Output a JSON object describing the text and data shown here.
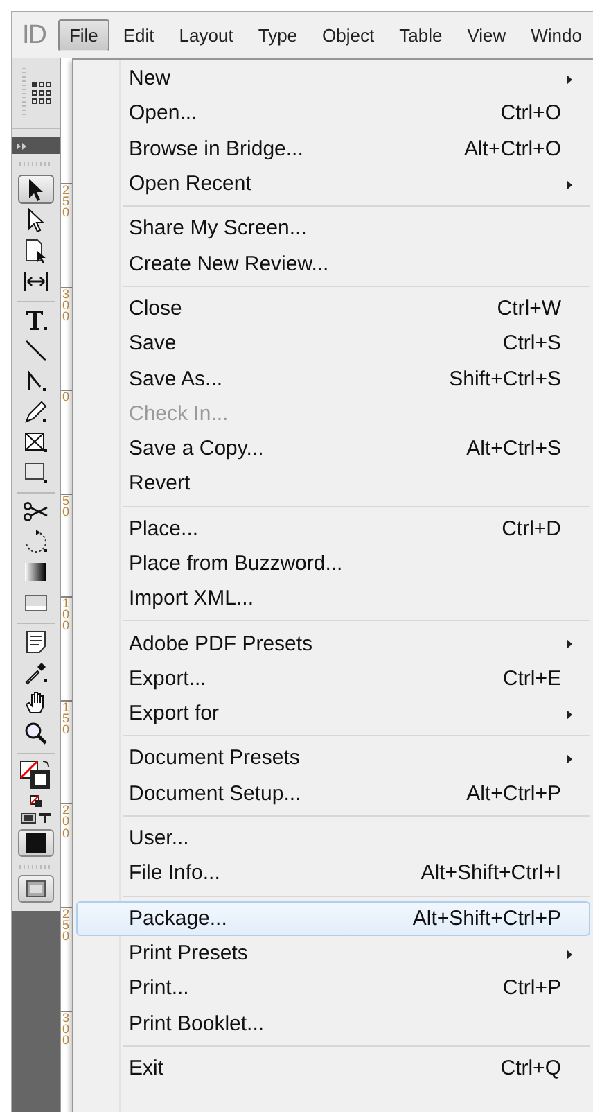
{
  "app": {
    "logo": "ID"
  },
  "menu_bar": [
    {
      "label": "File",
      "selected": true
    },
    {
      "label": "Edit",
      "selected": false
    },
    {
      "label": "Layout",
      "selected": false
    },
    {
      "label": "Type",
      "selected": false
    },
    {
      "label": "Object",
      "selected": false
    },
    {
      "label": "Table",
      "selected": false
    },
    {
      "label": "View",
      "selected": false
    },
    {
      "label": "Windo",
      "selected": false
    }
  ],
  "toolbar": {
    "groups": [
      [
        {
          "selected": true
        },
        {
          "selected": false
        },
        {
          "selected": false
        },
        {
          "selected": false
        }
      ],
      [
        {
          "selected": false
        },
        {
          "selected": false
        },
        {
          "selected": false
        },
        {
          "selected": false
        },
        {
          "selected": false
        },
        {
          "selected": false
        }
      ],
      [
        {
          "selected": false
        },
        {
          "selected": false
        },
        {
          "selected": false
        },
        {
          "selected": false
        }
      ],
      [
        {
          "selected": false
        },
        {
          "selected": false
        },
        {
          "selected": false
        },
        {
          "selected": false
        }
      ]
    ]
  },
  "ruler": {
    "labels": [
      "250",
      "300",
      "0",
      "50",
      "100",
      "150",
      "200",
      "250",
      "300"
    ]
  },
  "file_menu": {
    "sections": [
      {
        "items": [
          {
            "label": "New",
            "submenu": true,
            "disabled": false,
            "selected": false
          },
          {
            "label": "Open...",
            "shortcut": "Ctrl+O",
            "submenu": false,
            "disabled": false,
            "selected": false
          },
          {
            "label": "Browse in Bridge...",
            "shortcut": "Alt+Ctrl+O",
            "submenu": false,
            "disabled": false,
            "selected": false
          },
          {
            "label": "Open Recent",
            "submenu": true,
            "disabled": false,
            "selected": false
          }
        ]
      },
      {
        "items": [
          {
            "label": "Share My Screen...",
            "submenu": false,
            "disabled": false,
            "selected": false
          },
          {
            "label": "Create New Review...",
            "submenu": false,
            "disabled": false,
            "selected": false
          }
        ]
      },
      {
        "items": [
          {
            "label": "Close",
            "shortcut": "Ctrl+W",
            "submenu": false,
            "disabled": false,
            "selected": false
          },
          {
            "label": "Save",
            "shortcut": "Ctrl+S",
            "submenu": false,
            "disabled": false,
            "selected": false
          },
          {
            "label": "Save As...",
            "shortcut": "Shift+Ctrl+S",
            "submenu": false,
            "disabled": false,
            "selected": false
          },
          {
            "label": "Check In...",
            "submenu": false,
            "disabled": true,
            "selected": false
          },
          {
            "label": "Save a Copy...",
            "shortcut": "Alt+Ctrl+S",
            "submenu": false,
            "disabled": false,
            "selected": false
          },
          {
            "label": "Revert",
            "submenu": false,
            "disabled": false,
            "selected": false
          }
        ]
      },
      {
        "items": [
          {
            "label": "Place...",
            "shortcut": "Ctrl+D",
            "submenu": false,
            "disabled": false,
            "selected": false
          },
          {
            "label": "Place from Buzzword...",
            "submenu": false,
            "disabled": false,
            "selected": false
          },
          {
            "label": "Import XML...",
            "submenu": false,
            "disabled": false,
            "selected": false
          }
        ]
      },
      {
        "items": [
          {
            "label": "Adobe PDF Presets",
            "submenu": true,
            "disabled": false,
            "selected": false
          },
          {
            "label": "Export...",
            "shortcut": "Ctrl+E",
            "submenu": false,
            "disabled": false,
            "selected": false
          },
          {
            "label": "Export for",
            "submenu": true,
            "disabled": false,
            "selected": false
          }
        ]
      },
      {
        "items": [
          {
            "label": "Document Presets",
            "submenu": true,
            "disabled": false,
            "selected": false
          },
          {
            "label": "Document Setup...",
            "shortcut": "Alt+Ctrl+P",
            "submenu": false,
            "disabled": false,
            "selected": false
          }
        ]
      },
      {
        "items": [
          {
            "label": "User...",
            "submenu": false,
            "disabled": false,
            "selected": false
          },
          {
            "label": "File Info...",
            "shortcut": "Alt+Shift+Ctrl+I",
            "submenu": false,
            "disabled": false,
            "selected": false
          }
        ]
      },
      {
        "items": [
          {
            "label": "Package...",
            "shortcut": "Alt+Shift+Ctrl+P",
            "submenu": false,
            "disabled": false,
            "selected": true
          },
          {
            "label": "Print Presets",
            "submenu": true,
            "disabled": false,
            "selected": false
          },
          {
            "label": "Print...",
            "shortcut": "Ctrl+P",
            "submenu": false,
            "disabled": false,
            "selected": false
          },
          {
            "label": "Print Booklet...",
            "submenu": false,
            "disabled": false,
            "selected": false
          }
        ]
      },
      {
        "items": [
          {
            "label": "Exit",
            "shortcut": "Ctrl+Q",
            "submenu": false,
            "disabled": false,
            "selected": false
          }
        ]
      }
    ]
  }
}
